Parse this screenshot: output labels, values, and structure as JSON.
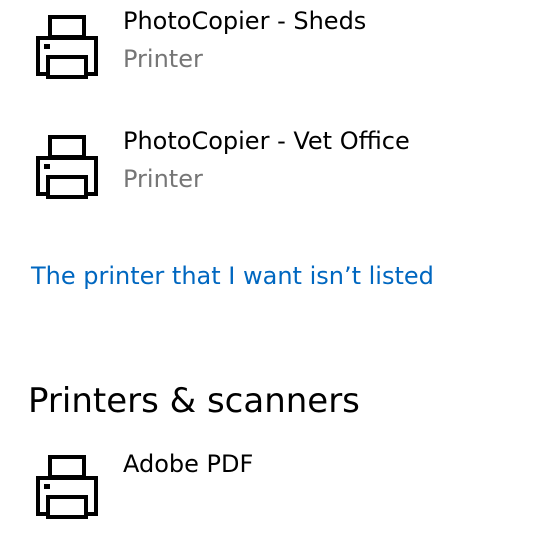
{
  "devices": [
    {
      "name": "PhotoCopier - Sheds",
      "type": "Printer",
      "icon": "printer-icon"
    },
    {
      "name": "PhotoCopier - Vet Office",
      "type": "Printer",
      "icon": "printer-icon"
    }
  ],
  "add_link": {
    "label": "The printer that I want isn’t listed",
    "color": "#0067c0"
  },
  "printers_section": {
    "title": "Printers & scanners",
    "items": [
      {
        "name": "Adobe PDF",
        "icon": "printer-icon"
      }
    ]
  }
}
